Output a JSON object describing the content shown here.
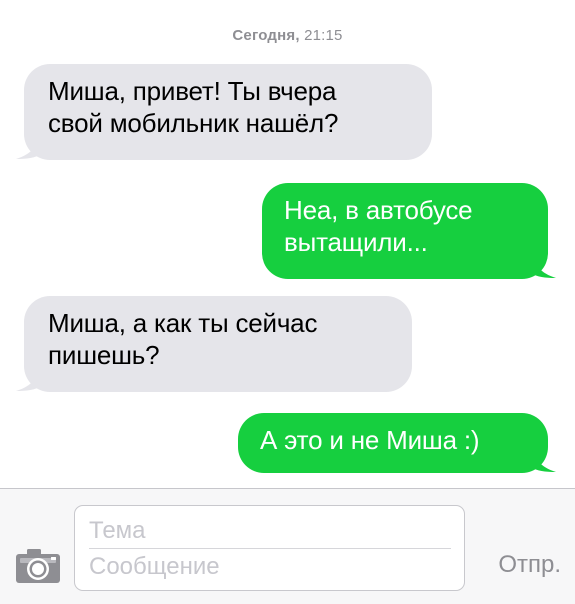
{
  "thread": {
    "timestamp_day": "Сегодня,",
    "timestamp_time": "21:15",
    "messages": [
      {
        "direction": "incoming",
        "text": "Миша, привет! Ты вчера\nсвой мобильник нашёл?"
      },
      {
        "direction": "outgoing",
        "text": "Неа, в автобусе\nвытащили..."
      },
      {
        "direction": "incoming",
        "text": "Миша, а как ты сейчас\nпишешь?"
      },
      {
        "direction": "outgoing",
        "text": "А это и не Миша :)"
      }
    ]
  },
  "composer": {
    "subject_placeholder": "Тема",
    "message_placeholder": "Сообщение",
    "send_label": "Отпр.",
    "camera_icon": "camera-icon"
  },
  "colors": {
    "incoming_bubble": "#e5e5ea",
    "outgoing_bubble": "#16cf3f",
    "timestamp": "#8e8e93",
    "placeholder": "#c7c7cd",
    "send_label": "#8e8e93"
  }
}
